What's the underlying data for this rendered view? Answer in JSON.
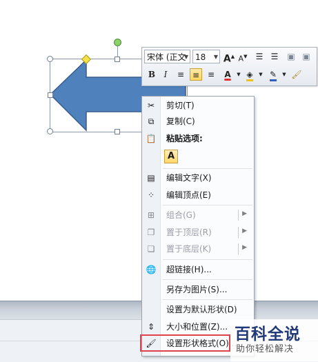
{
  "mini_toolbar": {
    "font_name": "宋体 (正文",
    "font_size": "18",
    "grow_font": "A",
    "shrink_font": "A",
    "bold": "B",
    "italic": "I",
    "font_color_label": "A"
  },
  "context_menu": {
    "items": [
      {
        "label": "剪切(T)",
        "icon": "scissors-icon",
        "enabled": true
      },
      {
        "label": "复制(C)",
        "icon": "copy-icon",
        "enabled": true
      },
      {
        "label": "粘贴选项:",
        "icon": "paste-icon",
        "enabled": true
      },
      {
        "label": "A",
        "icon": "paste-text-only-icon",
        "enabled": true
      },
      {
        "label": "编辑文字(X)",
        "icon": "edit-text-icon",
        "enabled": true
      },
      {
        "label": "编辑顶点(E)",
        "icon": "edit-points-icon",
        "enabled": true
      },
      {
        "label": "组合(G)",
        "icon": "group-icon",
        "enabled": false
      },
      {
        "label": "置于顶层(R)",
        "icon": "bring-to-front-icon",
        "enabled": false
      },
      {
        "label": "置于底层(K)",
        "icon": "send-to-back-icon",
        "enabled": false
      },
      {
        "label": "超链接(H)...",
        "icon": "hyperlink-icon",
        "enabled": true
      },
      {
        "label": "另存为图片(S)...",
        "icon": "",
        "enabled": true
      },
      {
        "label": "设置为默认形状(D)",
        "icon": "",
        "enabled": true
      },
      {
        "label": "大小和位置(Z)...",
        "icon": "size-position-icon",
        "enabled": true
      },
      {
        "label": "设置形状格式(O)...",
        "icon": "format-shape-icon",
        "enabled": true
      }
    ]
  },
  "watermark": {
    "title": "百科全说",
    "subtitle": "助你轻松解决"
  },
  "colors": {
    "arrow_fill": "#4f81bd",
    "arrow_stroke": "#385d8a",
    "highlight": "#e0414b",
    "font_color_bar": "#e03030",
    "fill_color_bar": "#f0c020",
    "outline_color_bar": "#3060c0"
  }
}
